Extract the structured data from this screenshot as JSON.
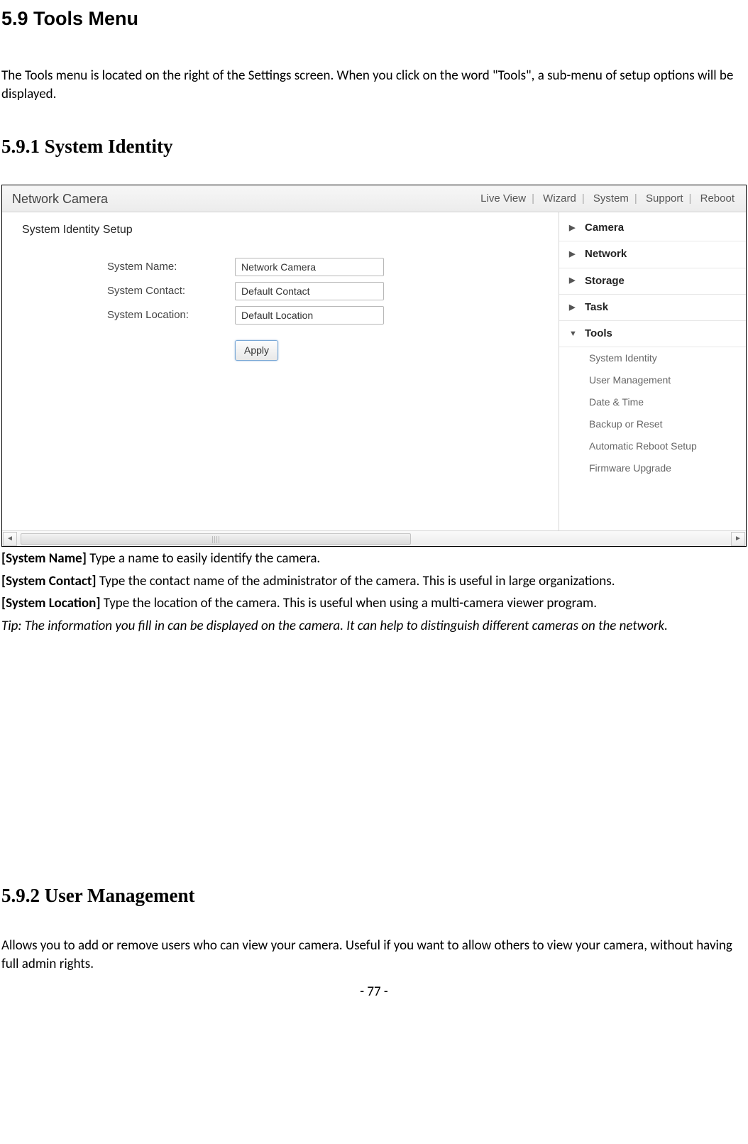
{
  "doc": {
    "h1": "5.9 Tools Menu",
    "intro": "The Tools menu is located on the right of the Settings screen. When you click on the word \"Tools\", a sub-menu of setup options will be displayed.",
    "h2a": "5.9.1 System Identity",
    "desc": {
      "sn_label": "[System Name] ",
      "sn_text": "Type a name to easily identify the camera.",
      "sc_label": "[System Contact] ",
      "sc_text": "Type the contact name of the administrator of the camera. This is useful in large organizations.",
      "sl_label": "[System Location] ",
      "sl_text": "Type the location of the camera. This is useful when using a multi-camera viewer program.",
      "tip": "Tip: The information you fill in can be displayed on the camera. It can help to distinguish different cameras on the network."
    },
    "h2b": "5.9.2 User Management",
    "um_text": "Allows you to add or remove users who can view your camera. Useful if you want to allow others to view your camera, without having full admin rights.",
    "footer": "- 77 -"
  },
  "ui": {
    "title": "Network Camera",
    "toplinks": [
      "Live View",
      "Wizard",
      "System",
      "Support",
      "Reboot"
    ],
    "panel_title": "System Identity Setup",
    "fields": {
      "name": {
        "label": "System Name:",
        "value": "Network Camera"
      },
      "contact": {
        "label": "System Contact:",
        "value": "Default Contact"
      },
      "location": {
        "label": "System Location:",
        "value": "Default Location"
      }
    },
    "apply": "Apply",
    "side": {
      "camera": "Camera",
      "network": "Network",
      "storage": "Storage",
      "task": "Task",
      "tools": "Tools",
      "tools_items": [
        "System Identity",
        "User Management",
        "Date & Time",
        "Backup or Reset",
        "Automatic Reboot Setup",
        "Firmware Upgrade"
      ]
    }
  }
}
